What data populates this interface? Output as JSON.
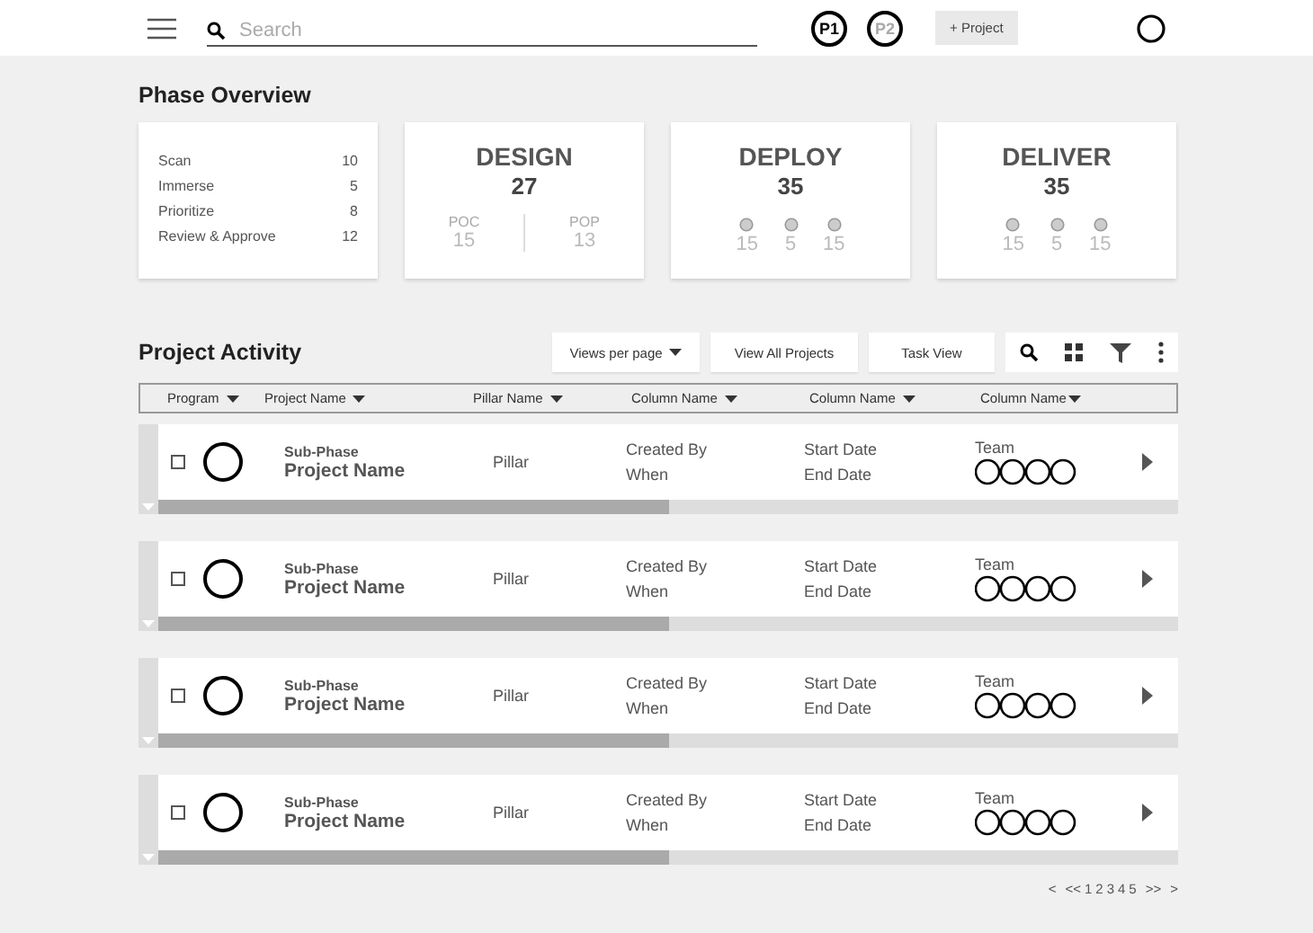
{
  "topbar": {
    "search": {
      "placeholder": "Search"
    },
    "profiles": [
      {
        "label": "P1",
        "selected": true
      },
      {
        "label": "P2",
        "selected": false
      }
    ],
    "add_button": "+ Project"
  },
  "phase_overview": {
    "title": "Phase Overview",
    "cards": [
      {
        "kind": "list",
        "items": [
          {
            "label": "Scan",
            "value": "10"
          },
          {
            "label": "Immerse",
            "value": "5"
          },
          {
            "label": "Prioritize",
            "value": "8"
          },
          {
            "label": "Review & Approve",
            "value": "12"
          }
        ]
      },
      {
        "kind": "split",
        "title": "DESIGN",
        "total": "27",
        "parts": [
          {
            "label": "POC",
            "value": "15"
          },
          {
            "label": "POP",
            "value": "13"
          }
        ]
      },
      {
        "kind": "dots",
        "title": "DEPLOY",
        "total": "35",
        "parts": [
          {
            "value": "15"
          },
          {
            "value": "5"
          },
          {
            "value": "15"
          }
        ]
      },
      {
        "kind": "dots",
        "title": "DELIVER",
        "total": "35",
        "parts": [
          {
            "value": "15"
          },
          {
            "value": "5"
          },
          {
            "value": "15"
          }
        ]
      }
    ]
  },
  "project_activity": {
    "title": "Project Activity",
    "buttons": [
      "Views per page",
      "View All Projects",
      "Task View"
    ],
    "columns": [
      "Program",
      "Project Name",
      "Pillar Name",
      "Column Name",
      "Column Name",
      "Column Name"
    ],
    "rows": [
      {
        "checked": false,
        "sub_phase": "Sub-Phase",
        "name": "Project Name",
        "pillar": "Pillar",
        "created_by": "Created By",
        "when": "When",
        "start": "Start Date",
        "end": "End Date",
        "team_label": "Team",
        "level": 0.5
      },
      {
        "checked": false,
        "sub_phase": "Sub-Phase",
        "name": "Project Name",
        "pillar": "Pillar",
        "created_by": "Created By",
        "when": "When",
        "start": "Start Date",
        "end": "End Date",
        "team_label": "Team",
        "level": 0.5
      },
      {
        "checked": false,
        "sub_phase": "Sub-Phase",
        "name": "Project Name",
        "pillar": "Pillar",
        "created_by": "Created By",
        "when": "When",
        "start": "Start Date",
        "end": "End Date",
        "team_label": "Team",
        "level": 0.5
      },
      {
        "checked": false,
        "sub_phase": "Sub-Phase",
        "name": "Project Name",
        "pillar": "Pillar",
        "created_by": "Created By",
        "when": "When",
        "start": "Start Date",
        "end": "End Date",
        "team_label": "Team",
        "level": 0.5
      }
    ],
    "pagination": [
      "<",
      "<<",
      "1",
      "2",
      "3",
      "4",
      "5",
      ">>",
      ">"
    ]
  }
}
